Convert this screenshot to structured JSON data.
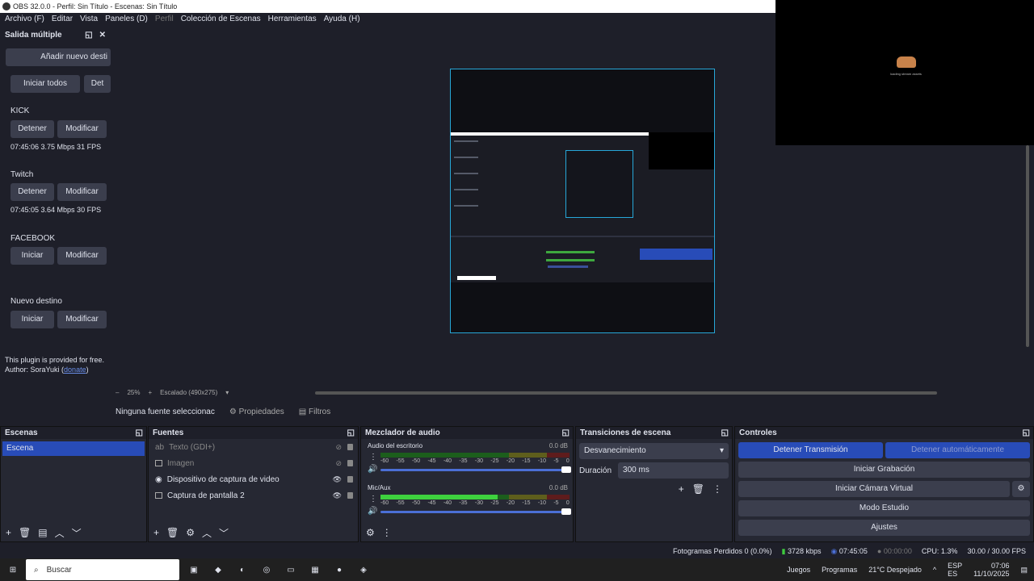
{
  "window": {
    "title": "OBS 32.0.0 - Perfil: Sin Título - Escenas: Sin Título"
  },
  "menu": [
    "Archivo (F)",
    "Editar",
    "Vista",
    "Paneles (D)",
    "Perfil",
    "Colección de Escenas",
    "Herramientas",
    "Ayuda (H)"
  ],
  "overlay_text": "loading stream assets",
  "multi": {
    "title": "Salida múltiple",
    "add_label": "Añadir nuevo desti",
    "start_all": "Iniciar todos",
    "stop_all": "Det",
    "targets": [
      {
        "name": "KICK",
        "button": "Detener",
        "modify": "Modificar",
        "stats": "07:45:06  3.75 Mbps  31 FPS"
      },
      {
        "name": "Twitch",
        "button": "Detener",
        "modify": "Modificar",
        "stats": "07:45:05  3.64 Mbps  30 FPS"
      },
      {
        "name": "FACEBOOK",
        "button": "Iniciar",
        "modify": "Modificar",
        "stats": ""
      },
      {
        "name": "Nuevo destino",
        "button": "Iniciar",
        "modify": "Modificar",
        "stats": ""
      }
    ],
    "footer1": "This plugin is provided for free.",
    "footer2_prefix": "Author: SoraYuki (",
    "footer2_link": "donate",
    "footer2_suffix": ")"
  },
  "zoom": {
    "minus": "–",
    "level": "25%",
    "plus": "+",
    "scale": "Escalado (490x275)"
  },
  "props": {
    "selection": "Ninguna fuente seleccionac",
    "properties": "Propiedades",
    "filters": "Filtros"
  },
  "scenes": {
    "title": "Escenas",
    "items": [
      "Escena"
    ]
  },
  "sources": {
    "title": "Fuentes",
    "items": [
      "Texto (GDI+)",
      "Imagen",
      "Dispositivo de captura de video",
      "Captura de pantalla 2"
    ]
  },
  "mixer": {
    "title": "Mezclador de audio",
    "ticks": [
      "-60",
      "-55",
      "-50",
      "-45",
      "-40",
      "-35",
      "-30",
      "-25",
      "-20",
      "-15",
      "-10",
      "-5",
      "0"
    ],
    "channels": [
      {
        "name": "Audio del escritorio",
        "db": "0.0 dB",
        "level": 0.0
      },
      {
        "name": "Mic/Aux",
        "db": "0.0 dB",
        "level": 0.62
      }
    ]
  },
  "transitions": {
    "title": "Transiciones de escena",
    "selected": "Desvanecimiento",
    "duration_label": "Duración",
    "duration": "300 ms"
  },
  "controls": {
    "title": "Controles",
    "stop_stream": "Detener Transmisión",
    "stop_auto": "Detener automáticamente",
    "record": "Iniciar Grabación",
    "vcam": "Iniciar Cámara Virtual",
    "studio": "Modo Estudio",
    "settings": "Ajustes"
  },
  "status": {
    "dropped": "Fotogramas Perdidos 0 (0.0%)",
    "bitrate": "3728 kbps",
    "stream_time": "07:45:05",
    "rec_time": "00:00:00",
    "cpu": "CPU: 1.3%",
    "fps": "30.00 / 30.00 FPS"
  },
  "taskbar": {
    "search": "Buscar",
    "games": "Juegos",
    "programs": "Programas",
    "weather": "21°C  Despejado",
    "lang1": "ESP",
    "lang2": "ES",
    "time": "07:06",
    "date": "11/10/2025"
  },
  "colors": {
    "accent": "#284cb8",
    "bg": "#1e1f29",
    "panel": "#262833",
    "select": "#27a7d8"
  }
}
